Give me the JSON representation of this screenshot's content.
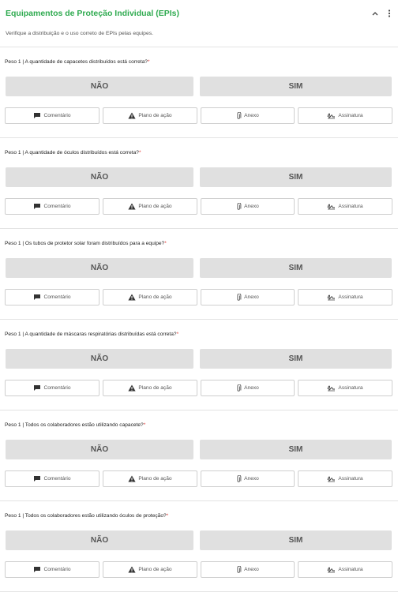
{
  "section": {
    "title": "Equipamentos de Proteção Individual (EPIs)",
    "subtitle": "Verifique a distribuição e o uso correto de EPIs pelas equipes.",
    "collapse_icon": "chevron-up-icon",
    "menu_icon": "more-vertical-icon"
  },
  "questions": [
    {
      "text": "Peso 1 | A quantidade de capacetes distribuídos está correta?",
      "required": "*"
    },
    {
      "text": "Peso 1 | A quantidade de óculos distribuídos está correta?",
      "required": "*"
    },
    {
      "text": "Peso 1 | Os tubos de protetor solar foram distribuídos para a equipe?",
      "required": "*"
    },
    {
      "text": "Peso 1 | A quantidade de máscaras respiratórias distribuídas está correta?",
      "required": "*"
    },
    {
      "text": "Peso 1 | Todos os colaboradores estão utilizando capacete?",
      "required": "*"
    },
    {
      "text": "Peso 1 | Todos os colaboradores estão utilizando óculos de proteção?",
      "required": "*"
    }
  ],
  "answers": {
    "no": "NÃO",
    "yes": "SIM"
  },
  "actions": {
    "comment": {
      "label": "Comentário",
      "icon": "comment-icon"
    },
    "action_plan": {
      "label": "Plano de ação",
      "icon": "warning-icon"
    },
    "attachment": {
      "label": "Anexo",
      "icon": "paperclip-icon"
    },
    "signature": {
      "label": "Assinatura",
      "icon": "signature-icon"
    }
  },
  "colors": {
    "title": "#2eaa4f",
    "required": "#e53935",
    "answer_bg": "#e0e0e0"
  }
}
